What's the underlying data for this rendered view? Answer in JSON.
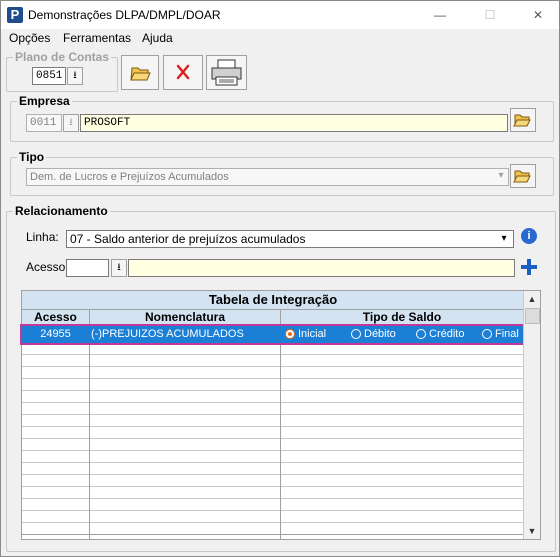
{
  "window": {
    "app_icon": "P",
    "title": "Demonstrações DLPA/DMPL/DOAR",
    "minimize_icon": "—",
    "maximize_icon": "☐",
    "close_icon": "✕"
  },
  "menu": [
    "Opções",
    "Ferramentas",
    "Ajuda"
  ],
  "plano_de_contas": {
    "legend": "Plano de Contas",
    "value": "0851"
  },
  "toolbar": {
    "open_icon": "folder-open-icon",
    "delete_icon": "delete-x-icon",
    "print_icon": "printer-icon"
  },
  "empresa": {
    "legend": "Empresa",
    "code": "0011",
    "name": "PROSOFT"
  },
  "tipo": {
    "legend": "Tipo",
    "value": "Dem. de Lucros e Prejuízos Acumulados"
  },
  "relacionamento": {
    "legend": "Relacionamento",
    "linha_label": "Linha:",
    "linha_value": "07 - Saldo anterior de prejuízos acumulados",
    "acesso_label": "Acesso:",
    "acesso_value": "",
    "acesso_desc": ""
  },
  "tabela": {
    "title": "Tabela de Integração",
    "columns": [
      "Acesso",
      "Nomenclatura",
      "Tipo de Saldo"
    ],
    "rows": [
      {
        "acesso": "24955",
        "nomenclatura": "(-)PREJUIZOS ACUMULADOS",
        "options": [
          "Inicial",
          "Débito",
          "Crédito",
          "Final"
        ],
        "selected": "Inicial"
      }
    ]
  },
  "colors": {
    "selection": "#1c7fd6",
    "highlight_border": "#c0399a",
    "header": "#d3e3f2",
    "add_button": "#1a5fc2",
    "info_icon": "#2a6ad0"
  }
}
